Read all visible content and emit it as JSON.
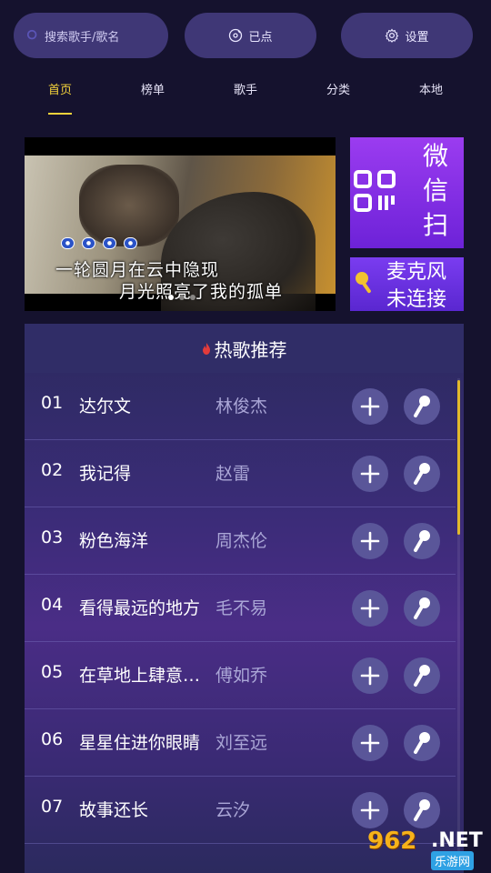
{
  "topbar": {
    "search_placeholder": "搜索歌手/歌名",
    "queued_label": "已点",
    "settings_label": "设置"
  },
  "tabs": [
    {
      "label": "首页",
      "active": true
    },
    {
      "label": "榜单",
      "active": false
    },
    {
      "label": "歌手",
      "active": false
    },
    {
      "label": "分类",
      "active": false
    },
    {
      "label": "本地",
      "active": false
    }
  ],
  "video": {
    "lyric_line_1": "一轮圆月在云中隐现",
    "lyric_line_2": "月光照亮了我的孤单"
  },
  "cards": {
    "wechat_text": "微信扫",
    "mic_text": "麦克风未连接"
  },
  "hot_songs": {
    "title": "热歌推荐",
    "rows": [
      {
        "num": "01",
        "title": "达尔文",
        "artist": "林俊杰"
      },
      {
        "num": "02",
        "title": "我记得",
        "artist": "赵雷"
      },
      {
        "num": "03",
        "title": "粉色海洋",
        "artist": "周杰伦"
      },
      {
        "num": "04",
        "title": "看得最远的地方",
        "artist": "毛不易"
      },
      {
        "num": "05",
        "title": "在草地上肆意奔跑",
        "artist": "傅如乔"
      },
      {
        "num": "06",
        "title": "星星住进你眼睛",
        "artist": "刘至远"
      },
      {
        "num": "07",
        "title": "故事还长",
        "artist": "云汐"
      }
    ]
  },
  "watermark": {
    "number": "962",
    "suffix": ".NET",
    "cn": "乐游网"
  },
  "colors": {
    "background": "#15122e",
    "accent": "#f5d33b",
    "pill": "#3f3776",
    "card_purple": "#9b3cf0"
  }
}
